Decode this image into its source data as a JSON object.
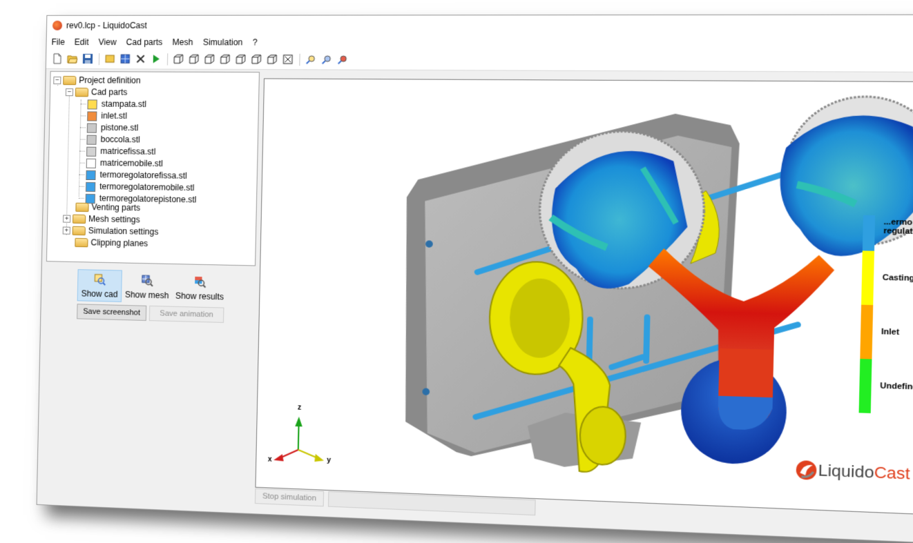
{
  "window": {
    "title": "rev0.lcp - LiquidoCast",
    "close_glyph": "✕"
  },
  "menu": [
    "File",
    "Edit",
    "View",
    "Cad parts",
    "Mesh",
    "Simulation",
    "?"
  ],
  "toolbar_icons": [
    "new-file-icon",
    "open-folder-icon",
    "save-icon",
    "box-icon",
    "grid-icon",
    "delete-icon",
    "play-icon",
    "view-cube-1-icon",
    "view-cube-2-icon",
    "view-cube-3-icon",
    "view-cube-4-icon",
    "view-cube-5-icon",
    "view-cube-6-icon",
    "view-cube-7-icon",
    "view-fit-icon",
    "zoom-icon",
    "zoom-mesh-icon",
    "zoom-results-icon"
  ],
  "tree": {
    "root": "Project definition",
    "cad_parts": "Cad parts",
    "parts": [
      {
        "name": "stampata.stl",
        "color": "#ffdc50"
      },
      {
        "name": "inlet.stl",
        "color": "#f08c3c"
      },
      {
        "name": "pistone.stl",
        "color": "#c8c8c8"
      },
      {
        "name": "boccola.stl",
        "color": "#c8c8c8"
      },
      {
        "name": "matricefissa.stl",
        "color": "#d2d2d2"
      },
      {
        "name": "matricemobile.stl",
        "color": "#ffffff"
      },
      {
        "name": "termoregolatorefissa.stl",
        "color": "#3ca0e6"
      },
      {
        "name": "termoregolatoremobile.stl",
        "color": "#3ca0e6"
      },
      {
        "name": "termoregolatorepistone.stl",
        "color": "#3ca0e6"
      }
    ],
    "venting": "Venting parts",
    "mesh": "Mesh settings",
    "simulation": "Simulation settings",
    "clipping": "Clipping planes"
  },
  "view_buttons": {
    "show_cad": "Show cad",
    "show_mesh": "Show mesh",
    "show_results": "Show results"
  },
  "buttons": {
    "save_screenshot": "Save screenshot",
    "save_animation": "Save animation",
    "stop_simulation": "Stop simulation"
  },
  "legend": [
    {
      "label": "Termo regulator",
      "line1": "...ermo",
      "line2": "regulator",
      "color": "#2f9fe0"
    },
    {
      "label": "Casting",
      "color": "#ffff00"
    },
    {
      "label": "Inlet",
      "color": "#ffa500"
    },
    {
      "label": "Undefined",
      "color": "#22ee22"
    }
  ],
  "axes": {
    "z": "z",
    "x": "x",
    "y": "y"
  },
  "logo": {
    "part1": "Liquido",
    "part2": "Cast"
  }
}
